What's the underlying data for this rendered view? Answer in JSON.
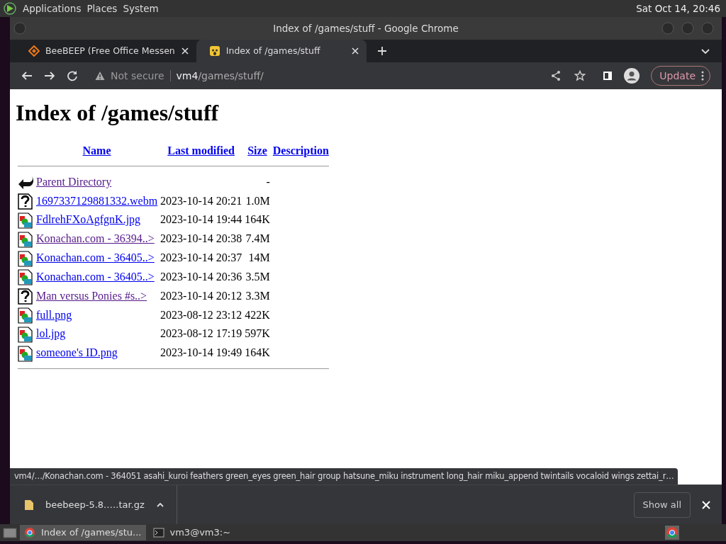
{
  "top_panel": {
    "menus": [
      "Applications",
      "Places",
      "System"
    ],
    "clock": "Sat Oct 14, 20:46"
  },
  "window": {
    "title": "Index of /games/stuff - Google Chrome"
  },
  "tabs": [
    {
      "label": "BeeBEEP (Free Office Messen",
      "selected": false,
      "kind": "diamond"
    },
    {
      "label": "Index of /games/stuff",
      "selected": true,
      "kind": "emoji"
    }
  ],
  "toolbar": {
    "security": "Not secure",
    "url_host": "vm4",
    "url_path": "/games/stuff/",
    "update": "Update"
  },
  "page": {
    "heading": "Index of /games/stuff",
    "columns": [
      "Name",
      "Last modified",
      "Size",
      "Description"
    ],
    "rows": [
      {
        "kind": "back",
        "name": "Parent Directory",
        "visited": true,
        "modified": "",
        "size": "-"
      },
      {
        "kind": "unknown",
        "name": "1697337129881332.webm",
        "visited": false,
        "modified": "2023-10-14 20:21",
        "size": "1.0M"
      },
      {
        "kind": "image",
        "name": "FdlrehFXoAgfgnK.jpg",
        "visited": false,
        "modified": "2023-10-14 19:44",
        "size": "164K"
      },
      {
        "kind": "image",
        "name": "Konachan.com - 36394..>",
        "visited": true,
        "modified": "2023-10-14 20:38",
        "size": "7.4M"
      },
      {
        "kind": "image",
        "name": "Konachan.com - 36405..>",
        "visited": false,
        "modified": "2023-10-14 20:37",
        "size": "14M"
      },
      {
        "kind": "image",
        "name": "Konachan.com - 36405..>",
        "visited": false,
        "modified": "2023-10-14 20:36",
        "size": "3.5M"
      },
      {
        "kind": "unknown",
        "name": "Man versus Ponies #s..>",
        "visited": true,
        "modified": "2023-10-14 20:12",
        "size": "3.3M"
      },
      {
        "kind": "image",
        "name": "full.png",
        "visited": false,
        "modified": "2023-08-12 23:12",
        "size": "422K"
      },
      {
        "kind": "image",
        "name": "lol.jpg",
        "visited": false,
        "modified": "2023-08-12 17:19",
        "size": "597K"
      },
      {
        "kind": "image",
        "name": "someone's ID.png",
        "visited": false,
        "modified": "2023-10-14 19:49",
        "size": "164K"
      }
    ]
  },
  "status_bubble": "vm4/…/Konachan.com - 364051 asahi_kuroi feathers green_eyes green_hair group hatsune_miku instrument long_hair miku_append twintails vocaloid wings zettai_r…",
  "download_shelf": {
    "file": "beebeep-5.8.….tar.gz",
    "show_all": "Show all"
  },
  "taskbar": {
    "items": [
      {
        "label": "Index of /games/stu...",
        "selected": true,
        "kind": "chrome"
      },
      {
        "label": "vm3@vm3:~",
        "selected": false,
        "kind": "terminal"
      }
    ]
  }
}
